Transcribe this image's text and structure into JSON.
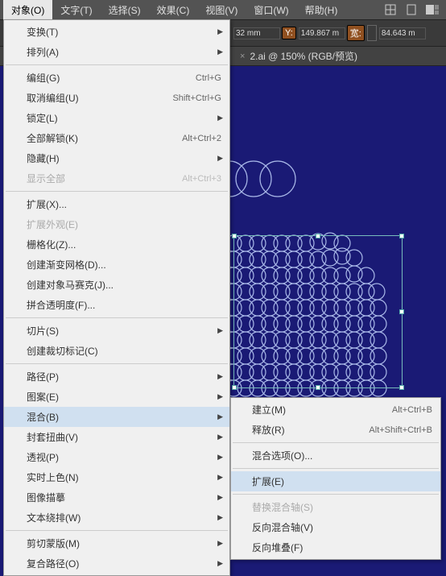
{
  "menubar": {
    "items": [
      {
        "label": "对象(O)",
        "active": true
      },
      {
        "label": "文字(T)"
      },
      {
        "label": "选择(S)"
      },
      {
        "label": "效果(C)"
      },
      {
        "label": "视图(V)"
      },
      {
        "label": "窗口(W)"
      },
      {
        "label": "帮助(H)"
      }
    ]
  },
  "toolbar": {
    "x_suffix": "32 mm",
    "y_label": "Y:",
    "y_val": "149.867 m",
    "w_label": "宽:",
    "w_val": "84.643 m"
  },
  "tab": {
    "title": "2.ai @ 150% (RGB/预览)"
  },
  "menu": {
    "items": [
      {
        "label": "变换(T)",
        "sub": true
      },
      {
        "label": "排列(A)",
        "sub": true
      },
      {
        "sep": true
      },
      {
        "label": "编组(G)",
        "shortcut": "Ctrl+G"
      },
      {
        "label": "取消编组(U)",
        "shortcut": "Shift+Ctrl+G"
      },
      {
        "label": "锁定(L)",
        "sub": true
      },
      {
        "label": "全部解锁(K)",
        "shortcut": "Alt+Ctrl+2"
      },
      {
        "label": "隐藏(H)",
        "sub": true
      },
      {
        "label": "显示全部",
        "shortcut": "Alt+Ctrl+3",
        "disabled": true
      },
      {
        "sep": true
      },
      {
        "label": "扩展(X)..."
      },
      {
        "label": "扩展外观(E)",
        "disabled": true
      },
      {
        "label": "栅格化(Z)..."
      },
      {
        "label": "创建渐变网格(D)..."
      },
      {
        "label": "创建对象马赛克(J)..."
      },
      {
        "label": "拼合透明度(F)..."
      },
      {
        "sep": true
      },
      {
        "label": "切片(S)",
        "sub": true
      },
      {
        "label": "创建裁切标记(C)"
      },
      {
        "sep": true
      },
      {
        "label": "路径(P)",
        "sub": true
      },
      {
        "label": "图案(E)",
        "sub": true
      },
      {
        "label": "混合(B)",
        "sub": true,
        "highlight": true
      },
      {
        "label": "封套扭曲(V)",
        "sub": true
      },
      {
        "label": "透视(P)",
        "sub": true
      },
      {
        "label": "实时上色(N)",
        "sub": true
      },
      {
        "label": "图像描摹",
        "sub": true
      },
      {
        "label": "文本绕排(W)",
        "sub": true
      },
      {
        "sep": true
      },
      {
        "label": "剪切蒙版(M)",
        "sub": true
      },
      {
        "label": "复合路径(O)",
        "sub": true
      }
    ]
  },
  "submenu": {
    "items": [
      {
        "label": "建立(M)",
        "shortcut": "Alt+Ctrl+B"
      },
      {
        "label": "释放(R)",
        "shortcut": "Alt+Shift+Ctrl+B"
      },
      {
        "sep": true
      },
      {
        "label": "混合选项(O)..."
      },
      {
        "sep": true
      },
      {
        "label": "扩展(E)",
        "highlight": true
      },
      {
        "sep": true
      },
      {
        "label": "替换混合轴(S)",
        "disabled": true
      },
      {
        "label": "反向混合轴(V)"
      },
      {
        "label": "反向堆叠(F)"
      }
    ]
  }
}
